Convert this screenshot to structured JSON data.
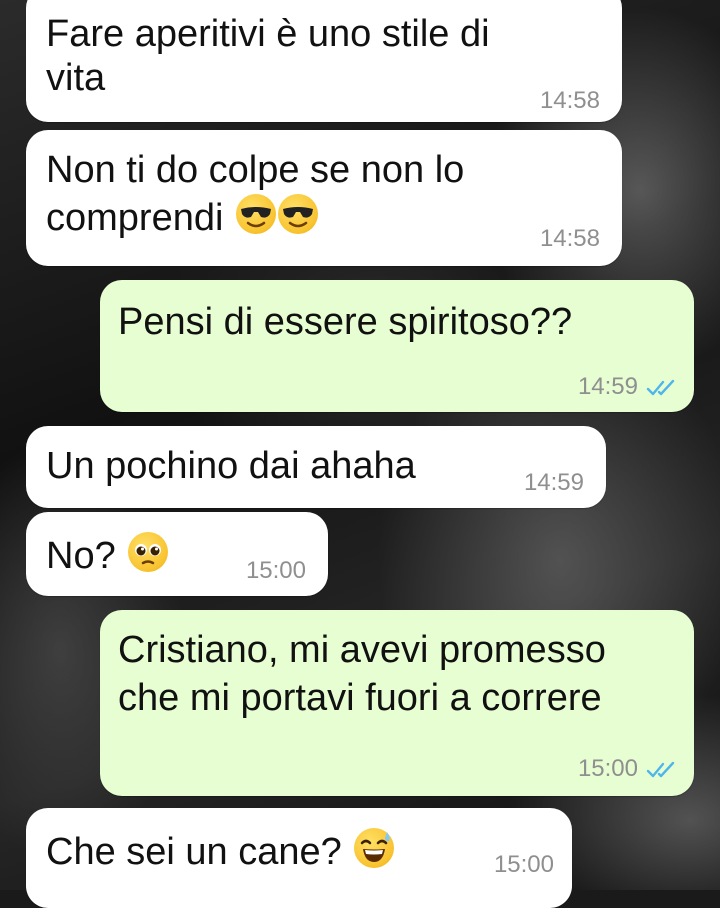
{
  "messages": [
    {
      "direction": "incoming",
      "text_lines": [
        "Fare aperitivi è uno stile di",
        "vita"
      ],
      "time": "14:58"
    },
    {
      "direction": "incoming",
      "text_lines": [
        "Non ti do colpe se non lo",
        "comprendi"
      ],
      "emojis": [
        "smiling-face-with-sunglasses",
        "smiling-face-with-sunglasses"
      ],
      "time": "14:58"
    },
    {
      "direction": "outgoing",
      "text_lines": [
        "Pensi di essere spiritoso??"
      ],
      "time": "14:59",
      "status": "read-double-check"
    },
    {
      "direction": "incoming",
      "text_lines": [
        "Un pochino dai ahaha"
      ],
      "time": "14:59"
    },
    {
      "direction": "incoming",
      "text_lines": [
        "No?"
      ],
      "emojis": [
        "pleading-face"
      ],
      "time": "15:00"
    },
    {
      "direction": "outgoing",
      "text_lines": [
        "Cristiano, mi avevi promesso",
        "che mi portavi fuori a correre"
      ],
      "time": "15:00",
      "status": "read-double-check"
    },
    {
      "direction": "incoming",
      "text_lines": [
        "Che sei un cane?"
      ],
      "emojis": [
        "grinning-face-with-sweat"
      ],
      "time": "15:00"
    }
  ],
  "colors": {
    "incoming_bubble": "#ffffff",
    "outgoing_bubble": "#e7fed2",
    "timestamp": "#8f8f8f",
    "read_ticks": "#4fb6ec"
  }
}
